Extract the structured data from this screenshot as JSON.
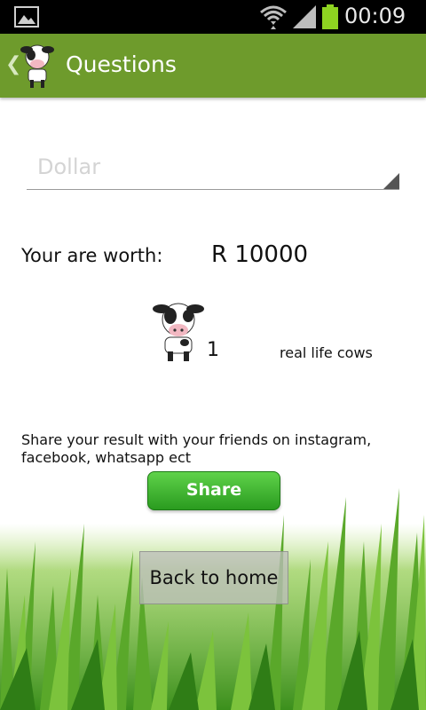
{
  "status_bar": {
    "time": "00:09",
    "icons": [
      "gallery-icon",
      "wifi-icon",
      "signal-icon",
      "battery-icon"
    ],
    "battery_color": "#8ed321"
  },
  "action_bar": {
    "title": "Questions",
    "color": "#6e9b2c",
    "icons": [
      "back-icon",
      "cow-icon"
    ]
  },
  "currency_spinner": {
    "selected": "Dollar"
  },
  "worth": {
    "label": "Your are worth:",
    "value": "R 10000"
  },
  "cows": {
    "count": "1",
    "unit": "real life cows",
    "icon": "cow-icon"
  },
  "share": {
    "message": "Share your result with your friends on instagram, facebook, whatsapp ect",
    "button_label": "Share",
    "button_color": "#3dbb2e"
  },
  "home_button": {
    "label": "Back to home"
  }
}
